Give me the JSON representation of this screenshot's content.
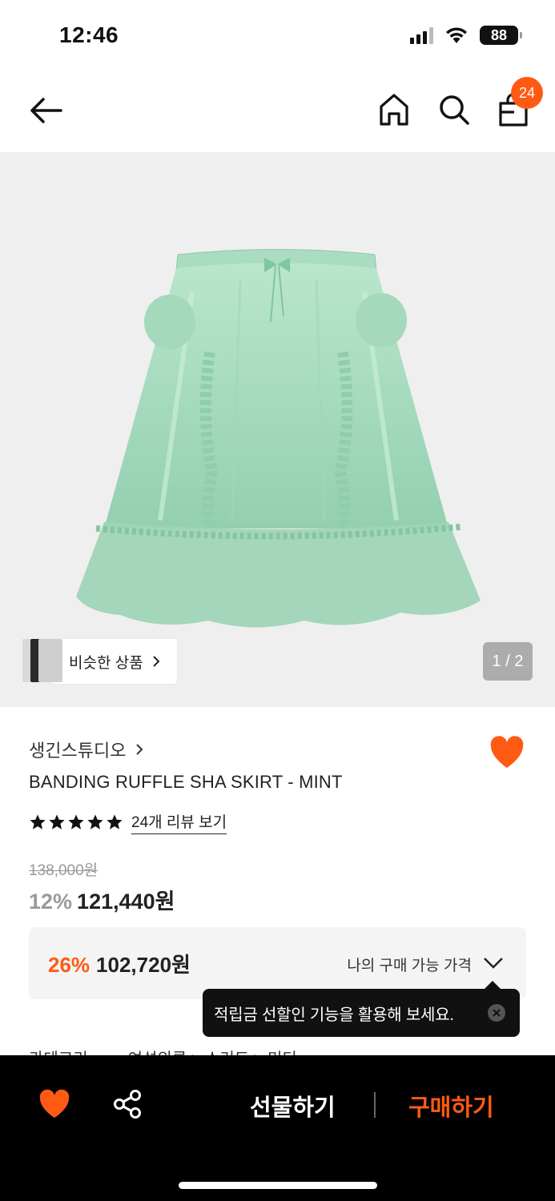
{
  "status_bar": {
    "time": "12:46",
    "battery": "88"
  },
  "nav": {
    "cart_count": "24"
  },
  "image": {
    "similar_label": "비슷한 상품",
    "page_indicator": "1 / 2"
  },
  "product": {
    "brand": "생긴스튜디오",
    "title": "BANDING RUFFLE SHA SKIRT - MINT",
    "rating_stars": 5,
    "review_link": "24개 리뷰 보기",
    "original_price": "138,000원",
    "discount_rate": "12%",
    "sale_price": "121,440원",
    "wishlisted": true
  },
  "my_price": {
    "rate": "26%",
    "price": "102,720원",
    "label": "나의 구매 가능 가격"
  },
  "tooltip": {
    "text": "적립금 선할인 기능을 활용해 보세요."
  },
  "category": {
    "label": "카테고리",
    "path": "여성의류 > 스커트 > 미디"
  },
  "bottom_bar": {
    "gift_label": "선물하기",
    "buy_label": "구매하기"
  },
  "colors": {
    "accent": "#ff5a14",
    "skirt": "#a8dcc0",
    "background": "#efefef"
  }
}
